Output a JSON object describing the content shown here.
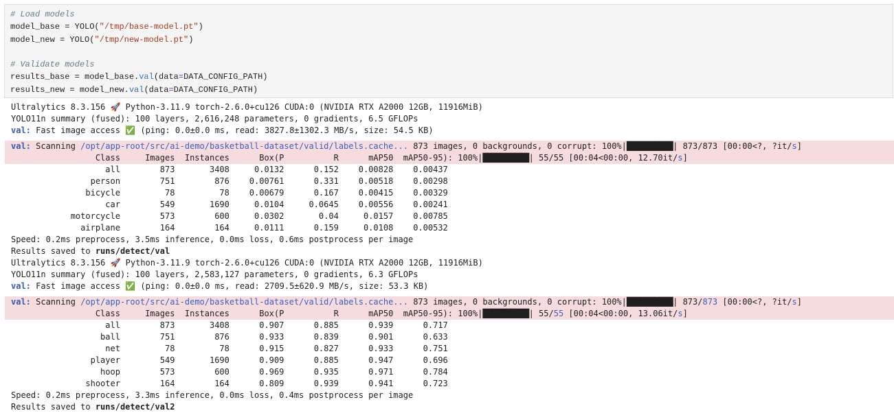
{
  "code_cell": {
    "comment_load": "# Load models",
    "line_base_var": "model_base = ",
    "line_base_fn": "YOLO(",
    "line_base_str": "\"/tmp/base-model.pt\"",
    "line_base_end": ")",
    "line_new_var": "model_new = ",
    "line_new_fn": "YOLO(",
    "line_new_str": "\"/tmp/new-model.pt\"",
    "line_new_end": ")",
    "comment_validate": "# Validate models",
    "line_rb_a": "results_base = model_base.",
    "line_rb_fn": "val",
    "line_rb_b": "(data",
    "line_rb_eq": "=",
    "line_rb_c": "DATA_CONFIG_PATH)",
    "line_rn_a": "results_new = model_new.",
    "line_rn_fn": "val",
    "line_rn_b": "(data",
    "line_rn_eq": "=",
    "line_rn_c": "DATA_CONFIG_PATH)"
  },
  "output1": {
    "header": "Ultralytics 8.3.156 🚀 Python-3.11.9 torch-2.6.0+cu126 CUDA:0 (NVIDIA RTX A2000 12GB, 11916MiB)",
    "summary": "YOLO11n summary (fused): 100 layers, 2,616,248 parameters, 0 gradients, 6.5 GFLOPs",
    "val_label": "val:",
    "access": " Fast image access ✅ (ping: 0.0±0.0 ms, read: 3827.8±1302.3 MB/s, size: 54.5 KB)",
    "scan_label": "val:",
    "scan_text": " Scanning ",
    "scan_path": "/opt/app-root/src/ai-demo/basketball-dataset/valid/labels.cache...",
    "scan_rest": " 873 images, 0 backgrounds, 0 corrupt: 100%|",
    "scan_bar": "██████████",
    "scan_tail_a": "| 873/873 [00:00<?, ?it/",
    "scan_tail_s": "s",
    "scan_tail_b": "]",
    "header_row": "                 Class     Images  Instances      Box(P          R      mAP50  mAP50-95): 100%|",
    "header_bar": "██████████",
    "header_tail_a": "| 55/55 [00:04<00:00, 12.70it/",
    "header_tail_s": "s",
    "header_tail_b": "]",
    "rows": [
      "                   all        873       3408     0.0132      0.152    0.00828    0.00437",
      "                person        751        876    0.00761      0.331    0.00518    0.00298",
      "               bicycle         78         78    0.00679      0.167    0.00415    0.00329",
      "                   car        549       1690     0.0104     0.0645    0.00556    0.00241",
      "            motorcycle        573        600     0.0302       0.04     0.0157    0.00785",
      "              airplane        164        164     0.0111      0.159     0.0108    0.00532"
    ],
    "speed": "Speed: 0.2ms preprocess, 3.5ms inference, 0.0ms loss, 0.6ms postprocess per image",
    "saved_prefix": "Results saved to ",
    "saved_path": "runs/detect/val"
  },
  "output2": {
    "header": "Ultralytics 8.3.156 🚀 Python-3.11.9 torch-2.6.0+cu126 CUDA:0 (NVIDIA RTX A2000 12GB, 11916MiB)",
    "summary": "YOLO11n summary (fused): 100 layers, 2,583,127 parameters, 0 gradients, 6.3 GFLOPs",
    "val_label": "val:",
    "access": " Fast image access ✅ (ping: 0.0±0.0 ms, read: 2709.5±620.9 MB/s, size: 53.3 KB)",
    "scan_label": "val:",
    "scan_text": " Scanning ",
    "scan_path": "/opt/app-root/src/ai-demo/basketball-dataset/valid/labels.cache...",
    "scan_rest": " 873 images, 0 backgrounds, 0 corrupt: 100%|",
    "scan_bar": "██████████",
    "scan_tail_a": "| 873/",
    "scan_tail_link": "873",
    "scan_tail_c": " [00:00<?, ?it/",
    "scan_tail_s": "s",
    "scan_tail_b": "]",
    "header_row": "                 Class     Images  Instances      Box(P          R      mAP50  mAP50-95): 100%|",
    "header_bar": "██████████",
    "header_tail_a": "| 55/",
    "header_tail_link": "55",
    "header_tail_c": " [00:04<00:00, 13.06it/",
    "header_tail_s": "s",
    "header_tail_b": "]",
    "rows": [
      "                   all        873       3408      0.907      0.885      0.939      0.717",
      "                  ball        751        876      0.933      0.839      0.901      0.633",
      "                   net         78         78      0.915      0.827      0.933      0.751",
      "                player        549       1690      0.909      0.885      0.947      0.696",
      "                  hoop        573        600      0.969      0.935      0.971      0.784",
      "               shooter        164        164      0.809      0.939      0.941      0.723"
    ],
    "speed": "Speed: 0.2ms preprocess, 3.3ms inference, 0.0ms loss, 0.4ms postprocess per image",
    "saved_prefix": "Results saved to ",
    "saved_path": "runs/detect/val2"
  }
}
